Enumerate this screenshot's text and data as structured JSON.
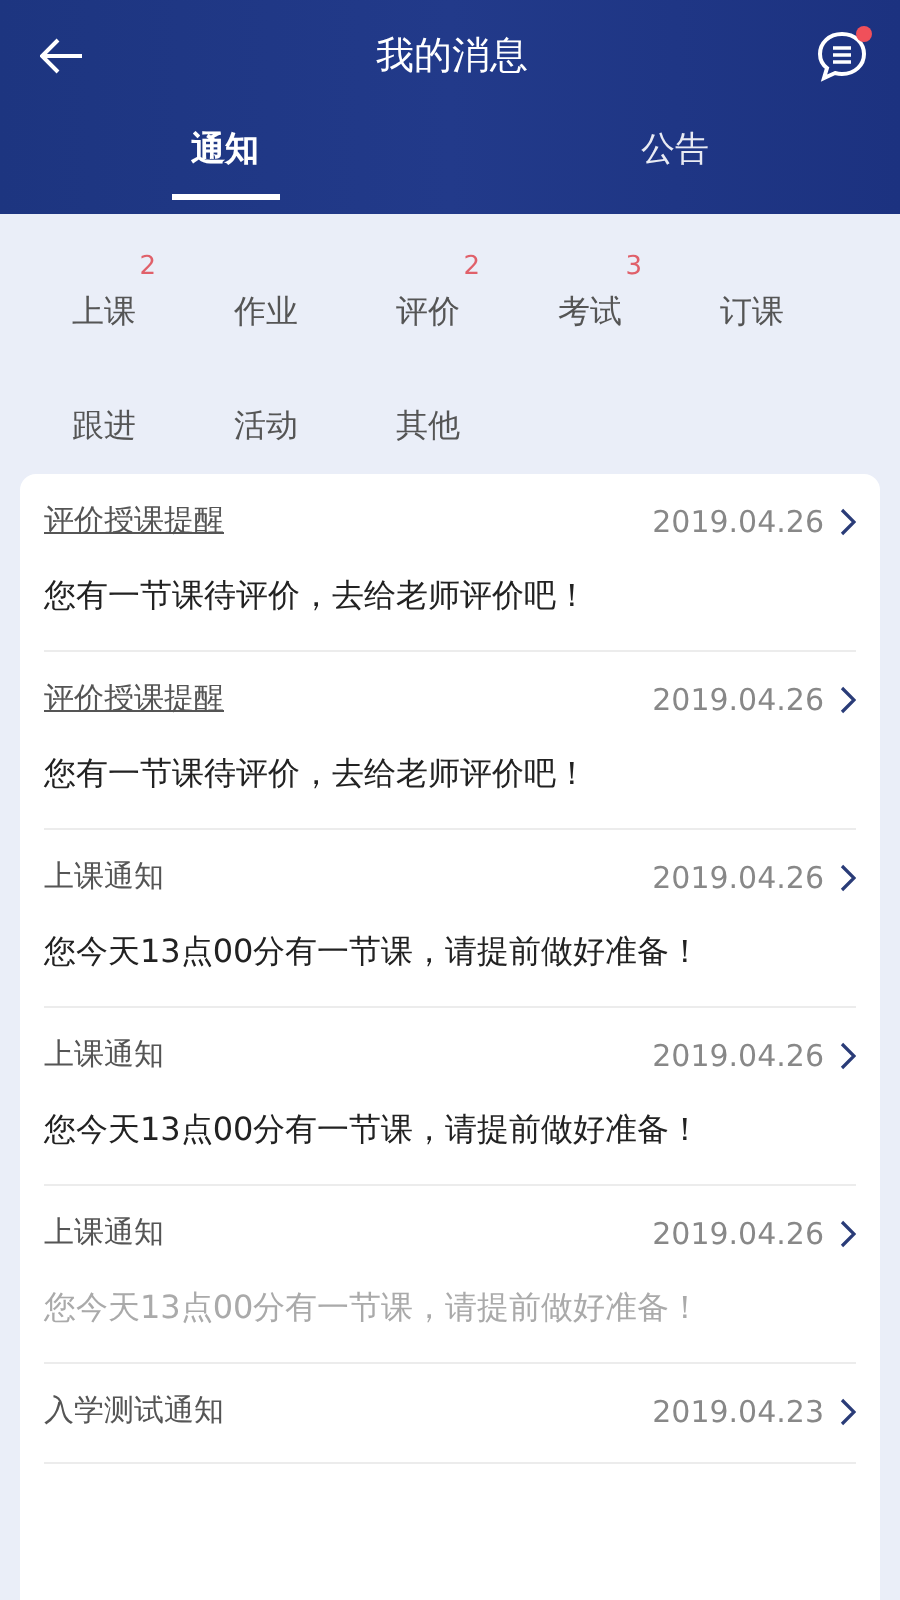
{
  "header": {
    "title": "我的消息",
    "has_unread": true
  },
  "tabs": [
    {
      "label": "通知",
      "selected": true
    },
    {
      "label": "公告",
      "selected": false
    }
  ],
  "categories": [
    {
      "label": "上课",
      "badge": "2"
    },
    {
      "label": "作业"
    },
    {
      "label": "评价",
      "badge": "2"
    },
    {
      "label": "考试",
      "badge": "3"
    },
    {
      "label": "订课"
    },
    {
      "label": "跟进"
    },
    {
      "label": "活动"
    },
    {
      "label": "其他"
    }
  ],
  "messages": [
    {
      "title": "评价授课提醒",
      "underlined": true,
      "date": "2019.04.26",
      "body": "您有一节课待评价，去给老师评价吧！",
      "read": false
    },
    {
      "title": "评价授课提醒",
      "underlined": true,
      "date": "2019.04.26",
      "body": "您有一节课待评价，去给老师评价吧！",
      "read": false
    },
    {
      "title": "上课通知",
      "underlined": false,
      "date": "2019.04.26",
      "body": "您今天13点00分有一节课，请提前做好准备！",
      "read": false
    },
    {
      "title": "上课通知",
      "underlined": false,
      "date": "2019.04.26",
      "body": "您今天13点00分有一节课，请提前做好准备！",
      "read": false
    },
    {
      "title": "上课通知",
      "underlined": false,
      "date": "2019.04.26",
      "body": "您今天13点00分有一节课，请提前做好准备！",
      "read": true
    },
    {
      "title": "入学测试通知",
      "underlined": false,
      "date": "2019.04.23"
    }
  ]
}
